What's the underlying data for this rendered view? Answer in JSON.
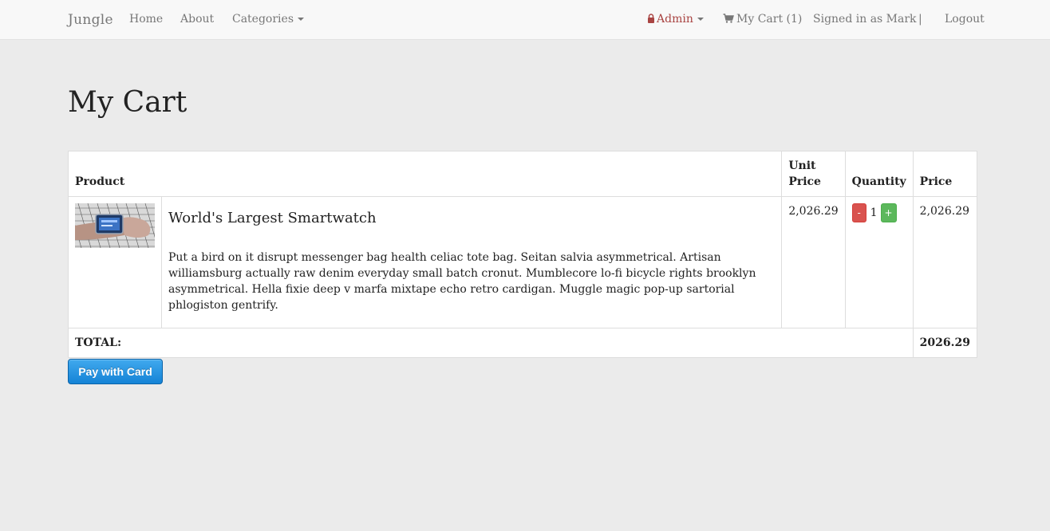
{
  "nav": {
    "brand": "Jungle",
    "home": "Home",
    "about": "About",
    "categories": "Categories",
    "admin": "Admin",
    "cart": "My Cart (1)",
    "signed_in": "Signed in as Mark",
    "separator": "|",
    "logout": "Logout"
  },
  "page": {
    "title": "My Cart"
  },
  "table": {
    "headers": {
      "product": "Product",
      "unit_price": "Unit Price",
      "quantity": "Quantity",
      "price": "Price"
    },
    "rows": [
      {
        "name": "World's Largest Smartwatch",
        "description": "Put a bird on it disrupt messenger bag health celiac tote bag. Seitan salvia asymmetrical. Artisan williamsburg actually raw denim everyday small batch cronut. Mumblecore lo-fi bicycle rights brooklyn asymmetrical. Hella fixie deep v marfa mixtape echo retro cardigan. Muggle magic pop-up sartorial phlogiston gentrify.",
        "unit_price": "2,026.29",
        "quantity": "1",
        "decrement": "-",
        "increment": "+",
        "price": "2,026.29"
      }
    ],
    "total_label": "TOTAL:",
    "total_value": "2026.29"
  },
  "checkout": {
    "pay_label": "Pay with Card"
  },
  "colors": {
    "admin": "#a94442",
    "minus_button": "#d9534f",
    "plus_button": "#5cb85c",
    "pay_button": "#1583d6"
  },
  "icons": {
    "admin": "lock-icon",
    "cart": "shopping-cart-icon",
    "dropdown": "caret-down-icon"
  }
}
